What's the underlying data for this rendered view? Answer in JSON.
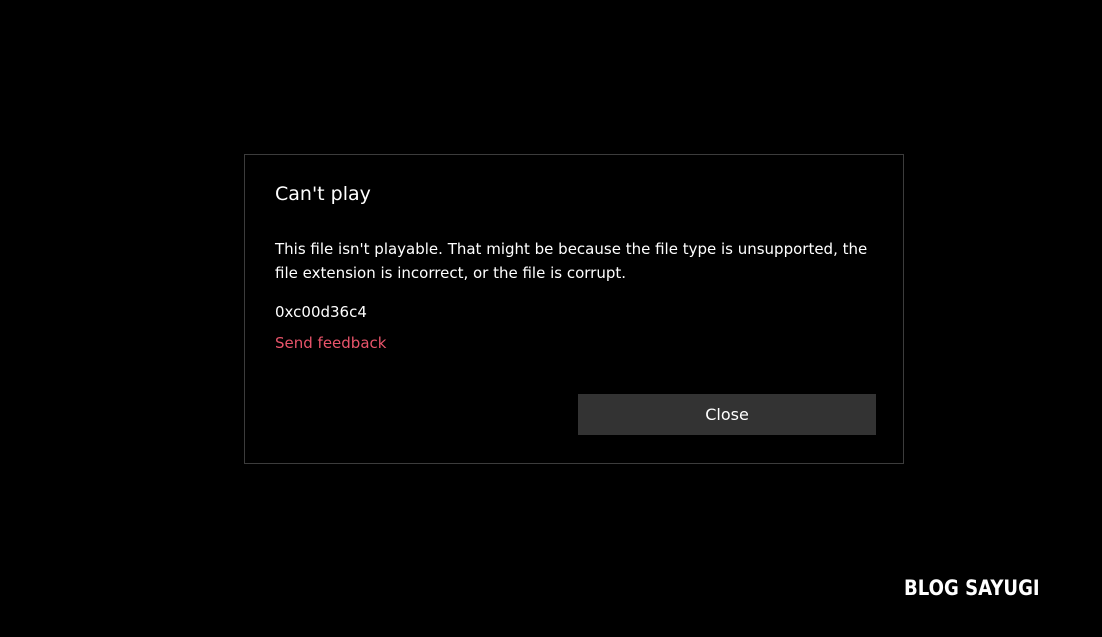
{
  "dialog": {
    "title": "Can't play",
    "message": "This file isn't playable. That might be because the file type is unsupported, the file extension is incorrect, or the file is corrupt.",
    "error_code": "0xc00d36c4",
    "feedback_link_label": "Send feedback",
    "close_button_label": "Close"
  },
  "watermark": {
    "text": "BLOG SAYUGI"
  },
  "colors": {
    "background": "#000000",
    "dialog_border": "#3c3c3c",
    "text": "#ffffff",
    "link": "#e8546a",
    "button_background": "#333333"
  }
}
